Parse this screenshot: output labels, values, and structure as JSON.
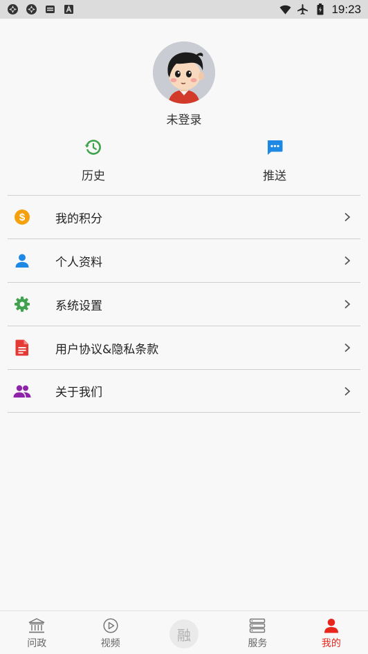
{
  "status_bar": {
    "time": "19:23",
    "left_icons": [
      "sync-icon",
      "sync-icon",
      "message-icon",
      "font-icon"
    ],
    "right_icons": [
      "wifi-icon",
      "airplane-icon",
      "battery-icon"
    ]
  },
  "profile": {
    "login_status": "未登录"
  },
  "quick_actions": [
    {
      "label": "历史",
      "icon": "history-icon",
      "color": "#3fa34d"
    },
    {
      "label": "推送",
      "icon": "chat-icon",
      "color": "#1e88e5"
    }
  ],
  "menu": [
    {
      "label": "我的积分",
      "icon": "dollar-coin-icon",
      "color": "#f5a00f"
    },
    {
      "label": "个人资料",
      "icon": "person-icon",
      "color": "#1e88e5"
    },
    {
      "label": "系统设置",
      "icon": "gear-icon",
      "color": "#3fa34d"
    },
    {
      "label": "用户协议&隐私条款",
      "icon": "document-icon",
      "color": "#e53935"
    },
    {
      "label": "关于我们",
      "icon": "group-icon",
      "color": "#8e24aa"
    }
  ],
  "bottom_nav": [
    {
      "label": "问政",
      "icon": "building-icon"
    },
    {
      "label": "视频",
      "icon": "play-circle-icon"
    },
    {
      "label": "融",
      "icon": "rong-badge"
    },
    {
      "label": "服务",
      "icon": "list-icon"
    },
    {
      "label": "我的",
      "icon": "person-icon",
      "active": true
    }
  ],
  "colors": {
    "accent_active": "#e8261c",
    "divider": "#cfcfcf",
    "background": "#f8f8f8"
  }
}
